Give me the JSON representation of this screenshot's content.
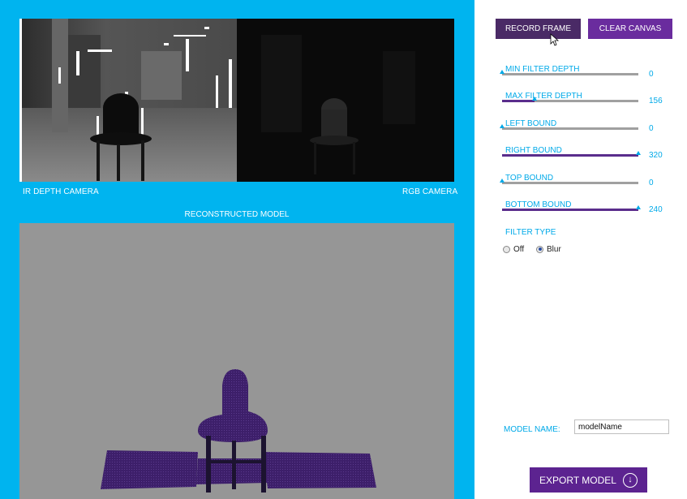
{
  "cameras": {
    "ir_label": "IR DEPTH CAMERA",
    "rgb_label": "RGB CAMERA"
  },
  "model_section": {
    "title": "RECONSTRUCTED MODEL"
  },
  "toolbar": {
    "record_label": "RECORD FRAME",
    "clear_label": "CLEAR CANVAS"
  },
  "sliders": [
    {
      "label": "MIN FILTER DEPTH",
      "value": "0",
      "fill": 0.0
    },
    {
      "label": "MAX FILTER DEPTH",
      "value": "156",
      "fill": 0.24
    },
    {
      "label": "LEFT BOUND",
      "value": "0",
      "fill": 0.0
    },
    {
      "label": "RIGHT BOUND",
      "value": "320",
      "fill": 1.0
    },
    {
      "label": "TOP BOUND",
      "value": "0",
      "fill": 0.0
    },
    {
      "label": "BOTTOM BOUND",
      "value": "240",
      "fill": 1.0
    }
  ],
  "filter": {
    "title": "FILTER TYPE",
    "options": [
      "Off",
      "Blur"
    ],
    "selected": "Blur"
  },
  "export": {
    "name_label": "MODEL NAME:",
    "name_value": "modelName",
    "button_label": "EXPORT MODEL"
  },
  "colors": {
    "panel_blue": "#00b4ef",
    "accent_purple": "#5c2390",
    "slider_blue": "#00a9e8"
  }
}
